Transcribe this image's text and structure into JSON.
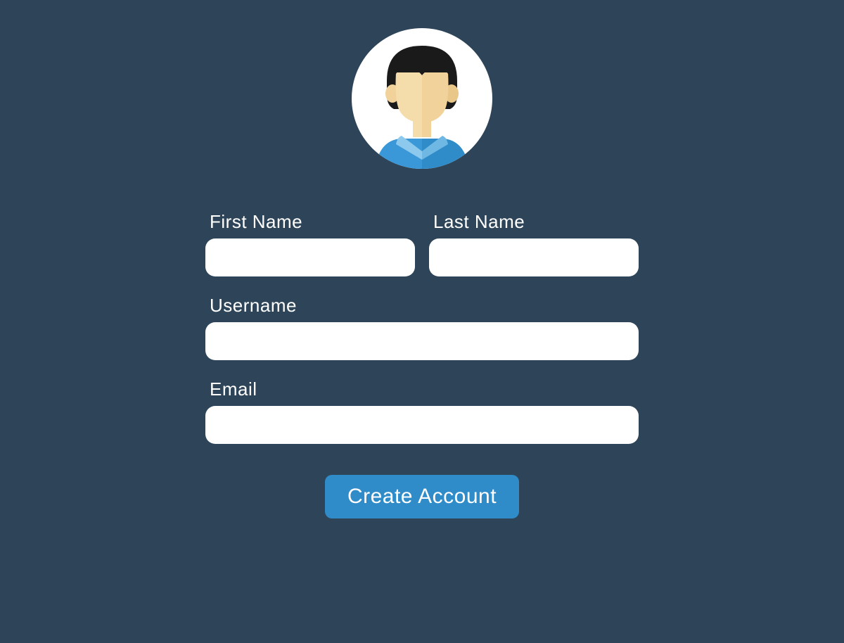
{
  "form": {
    "first_name": {
      "label": "First Name",
      "value": ""
    },
    "last_name": {
      "label": "Last Name",
      "value": ""
    },
    "username": {
      "label": "Username",
      "value": ""
    },
    "email": {
      "label": "Email",
      "value": ""
    },
    "submit_label": "Create Account"
  },
  "colors": {
    "background": "#2e4559",
    "accent": "#2f8cc9",
    "input_bg": "#ffffff",
    "text_light": "#ffffff"
  },
  "avatar_icon": "person-avatar-icon"
}
